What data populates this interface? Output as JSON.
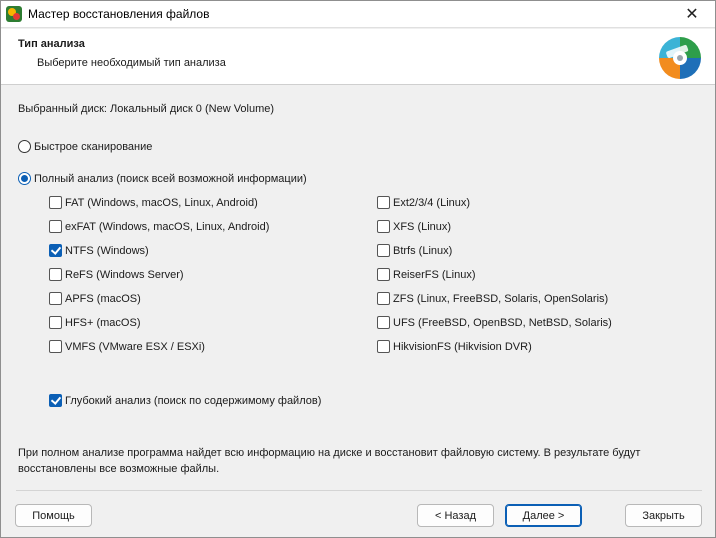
{
  "window": {
    "title": "Мастер восстановления файлов",
    "close_glyph": "✕"
  },
  "header": {
    "title": "Тип анализа",
    "subtitle": "Выберите необходимый тип анализа"
  },
  "disk_label": "Выбранный диск: Локальный диск 0 (New Volume)",
  "scan_modes": [
    {
      "label": "Быстрое сканирование",
      "selected": false
    },
    {
      "label": "Полный анализ (поиск всей возможной информации)",
      "selected": true
    }
  ],
  "filesystems_left": [
    {
      "label": "FAT (Windows, macOS, Linux, Android)",
      "checked": false
    },
    {
      "label": "exFAT (Windows, macOS, Linux, Android)",
      "checked": false
    },
    {
      "label": "NTFS (Windows)",
      "checked": true
    },
    {
      "label": "ReFS (Windows Server)",
      "checked": false
    },
    {
      "label": "APFS (macOS)",
      "checked": false
    },
    {
      "label": "HFS+ (macOS)",
      "checked": false
    },
    {
      "label": "VMFS (VMware ESX / ESXi)",
      "checked": false
    }
  ],
  "filesystems_right": [
    {
      "label": "Ext2/3/4 (Linux)",
      "checked": false
    },
    {
      "label": "XFS (Linux)",
      "checked": false
    },
    {
      "label": "Btrfs (Linux)",
      "checked": false
    },
    {
      "label": "ReiserFS (Linux)",
      "checked": false
    },
    {
      "label": "ZFS (Linux, FreeBSD, Solaris, OpenSolaris)",
      "checked": false
    },
    {
      "label": "UFS (FreeBSD, OpenBSD, NetBSD, Solaris)",
      "checked": false
    },
    {
      "label": "HikvisionFS (Hikvision DVR)",
      "checked": false
    }
  ],
  "deep_analysis": {
    "label": "Глубокий анализ (поиск по содержимому файлов)",
    "checked": true
  },
  "info_text": "При полном анализе программа найдет всю информацию на диске и восстановит файловую систему. В результате будут восстановлены все возможные файлы.",
  "buttons": {
    "help": "Помощь",
    "back": "< Назад",
    "next": "Далее >",
    "close": "Закрыть"
  },
  "colors": {
    "accent": "#0b5fb5",
    "window_bg": "#f0f0f0"
  }
}
